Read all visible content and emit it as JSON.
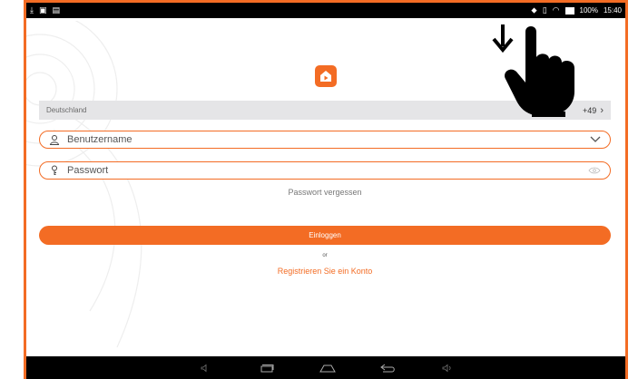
{
  "statusbar": {
    "battery_text": "100%",
    "time": "15:40"
  },
  "country": {
    "name": "Deutschland",
    "code": "+49"
  },
  "username": {
    "placeholder": "Benutzername"
  },
  "password": {
    "placeholder": "Passwort"
  },
  "forgot_password": "Passwort vergessen",
  "login_button": "Einloggen",
  "or_text": "or",
  "register_link": "Registrieren Sie ein Konto",
  "colors": {
    "accent": "#f36c24",
    "statusbar": "#000000"
  }
}
